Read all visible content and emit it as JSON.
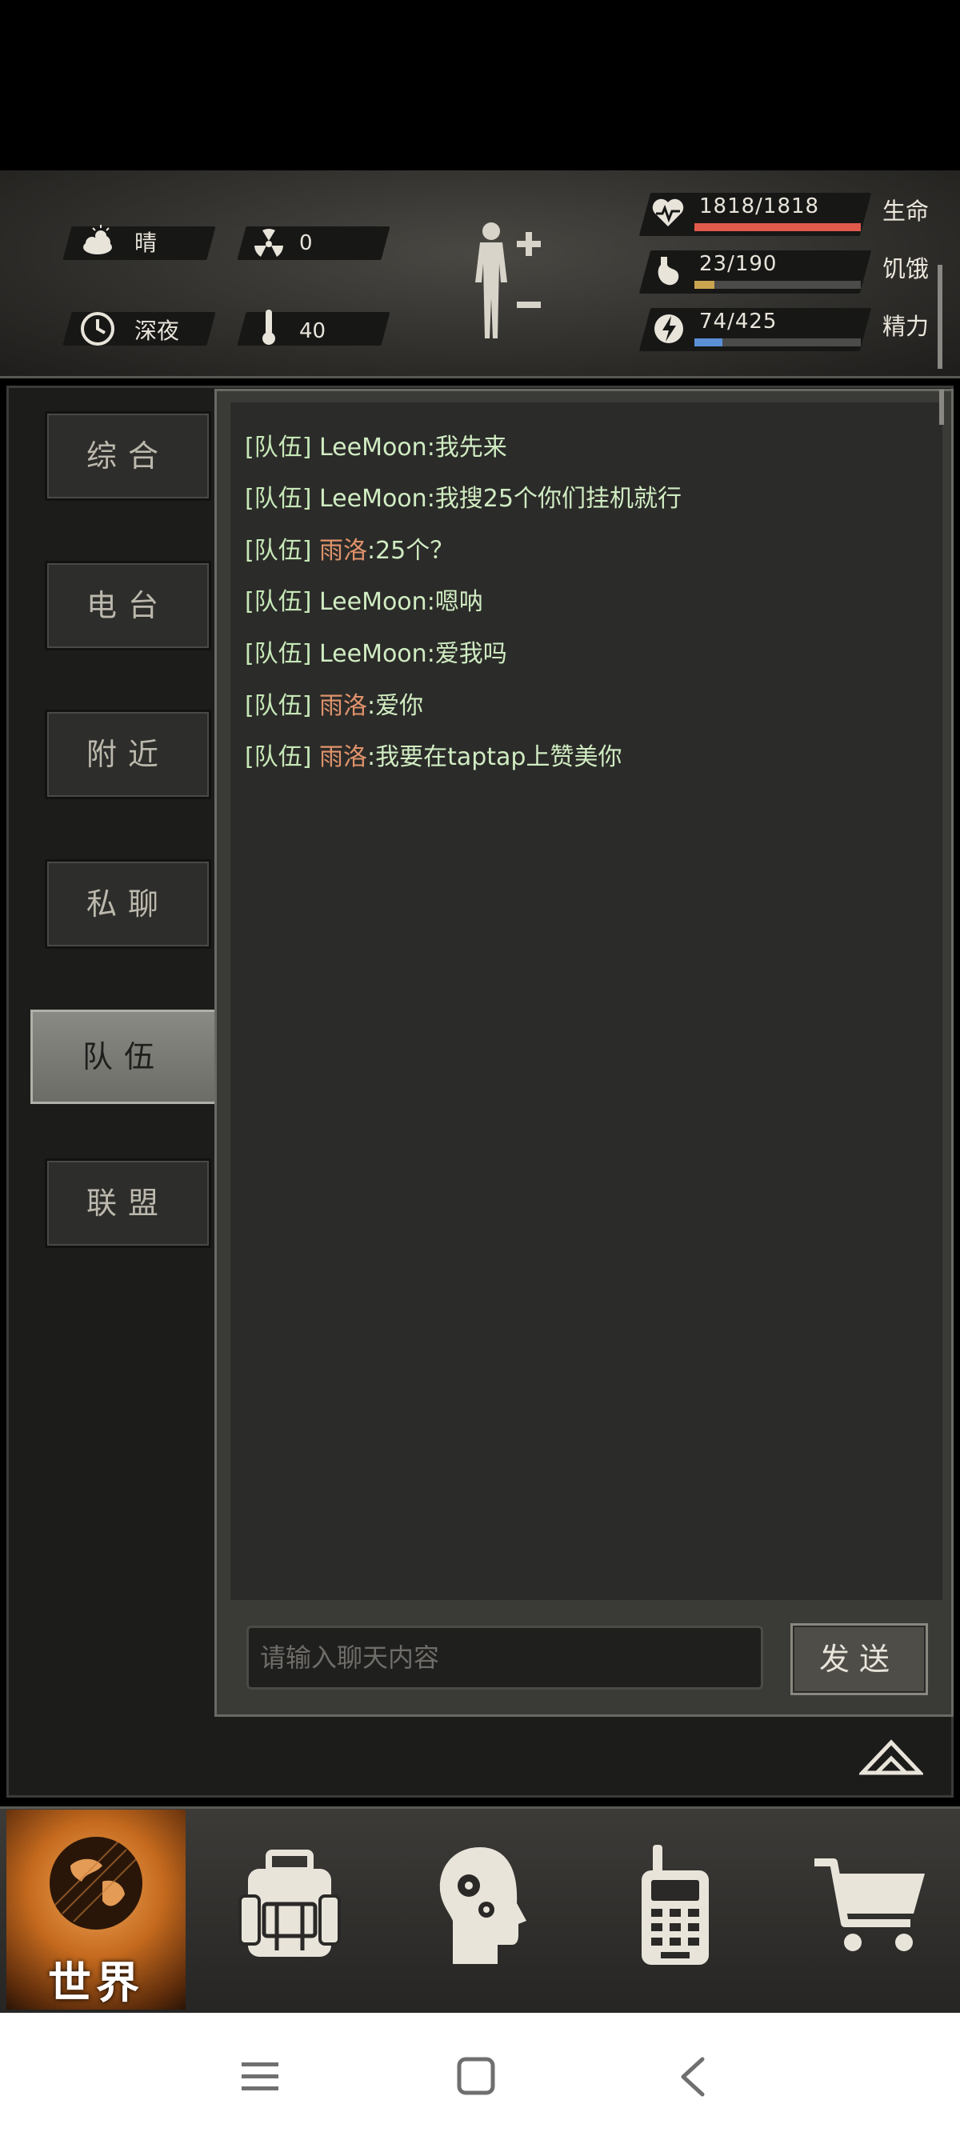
{
  "hud": {
    "weather": "晴",
    "radiation": "0",
    "time_of_day": "深夜",
    "temperature": "40",
    "stats": [
      {
        "label": "生命",
        "value": "1818/1818",
        "fill": 1.0,
        "color": "#e05a4c",
        "icon": "heart-icon"
      },
      {
        "label": "饥饿",
        "value": "23/190",
        "fill": 0.12,
        "color": "#c9a550",
        "icon": "stomach-icon"
      },
      {
        "label": "精力",
        "value": "74/425",
        "fill": 0.17,
        "color": "#5b8fd6",
        "icon": "energy-icon"
      }
    ]
  },
  "tabs": [
    {
      "label": "综合",
      "active": false
    },
    {
      "label": "电台",
      "active": false
    },
    {
      "label": "附近",
      "active": false
    },
    {
      "label": "私聊",
      "active": false
    },
    {
      "label": "队伍",
      "active": true
    },
    {
      "label": "联盟",
      "active": false
    }
  ],
  "messages": [
    {
      "channel": "[队伍]",
      "name": "LeeMoon",
      "text": ":我先来",
      "name_color": "green"
    },
    {
      "channel": "[队伍]",
      "name": "LeeMoon",
      "text": ":我搜25个你们挂机就行",
      "name_color": "green"
    },
    {
      "channel": "[队伍]",
      "name": "雨洛",
      "text": ":25个？",
      "name_color": "orange"
    },
    {
      "channel": "[队伍]",
      "name": "LeeMoon",
      "text": ":嗯呐",
      "name_color": "green"
    },
    {
      "channel": "[队伍]",
      "name": "LeeMoon",
      "text": ":爱我吗",
      "name_color": "green"
    },
    {
      "channel": "[队伍]",
      "name": "雨洛",
      "text": ":爱你",
      "name_color": "orange"
    },
    {
      "channel": "[队伍]",
      "name": "雨洛",
      "text": ":我要在taptap上赞美你",
      "name_color": "orange"
    }
  ],
  "chat_input": {
    "placeholder": "请输入聊天内容"
  },
  "send_label": "发送",
  "bottom_nav": {
    "world_label": "世界",
    "items": [
      "backpack-icon",
      "skills-head-icon",
      "radio-icon",
      "cart-icon"
    ]
  }
}
